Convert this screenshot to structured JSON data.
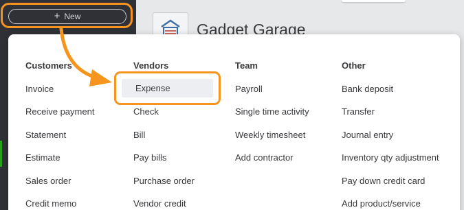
{
  "nav": {
    "new_button_label": "New",
    "new_button_icon": "plus-icon"
  },
  "header": {
    "company_name": "Gadget Garage",
    "company_logo": "garage-logo-icon"
  },
  "menu": {
    "columns": [
      {
        "header": "Customers",
        "items": [
          "Invoice",
          "Receive payment",
          "Statement",
          "Estimate",
          "Sales order",
          "Credit memo"
        ]
      },
      {
        "header": "Vendors",
        "items": [
          "Expense",
          "Check",
          "Bill",
          "Pay bills",
          "Purchase order",
          "Vendor credit"
        ]
      },
      {
        "header": "Team",
        "items": [
          "Payroll",
          "Single time activity",
          "Weekly timesheet",
          "Add contractor"
        ]
      },
      {
        "header": "Other",
        "items": [
          "Bank deposit",
          "Transfer",
          "Journal entry",
          "Inventory qty adjustment",
          "Pay down credit card",
          "Add product/service"
        ]
      }
    ]
  },
  "annotation": {
    "highlight_color": "#f7941d",
    "arrow_icon": "callout-arrow-icon"
  },
  "colors": {
    "sidebar": "#2f3136",
    "accent_green": "#2ca01c",
    "text": "#393a3d"
  }
}
